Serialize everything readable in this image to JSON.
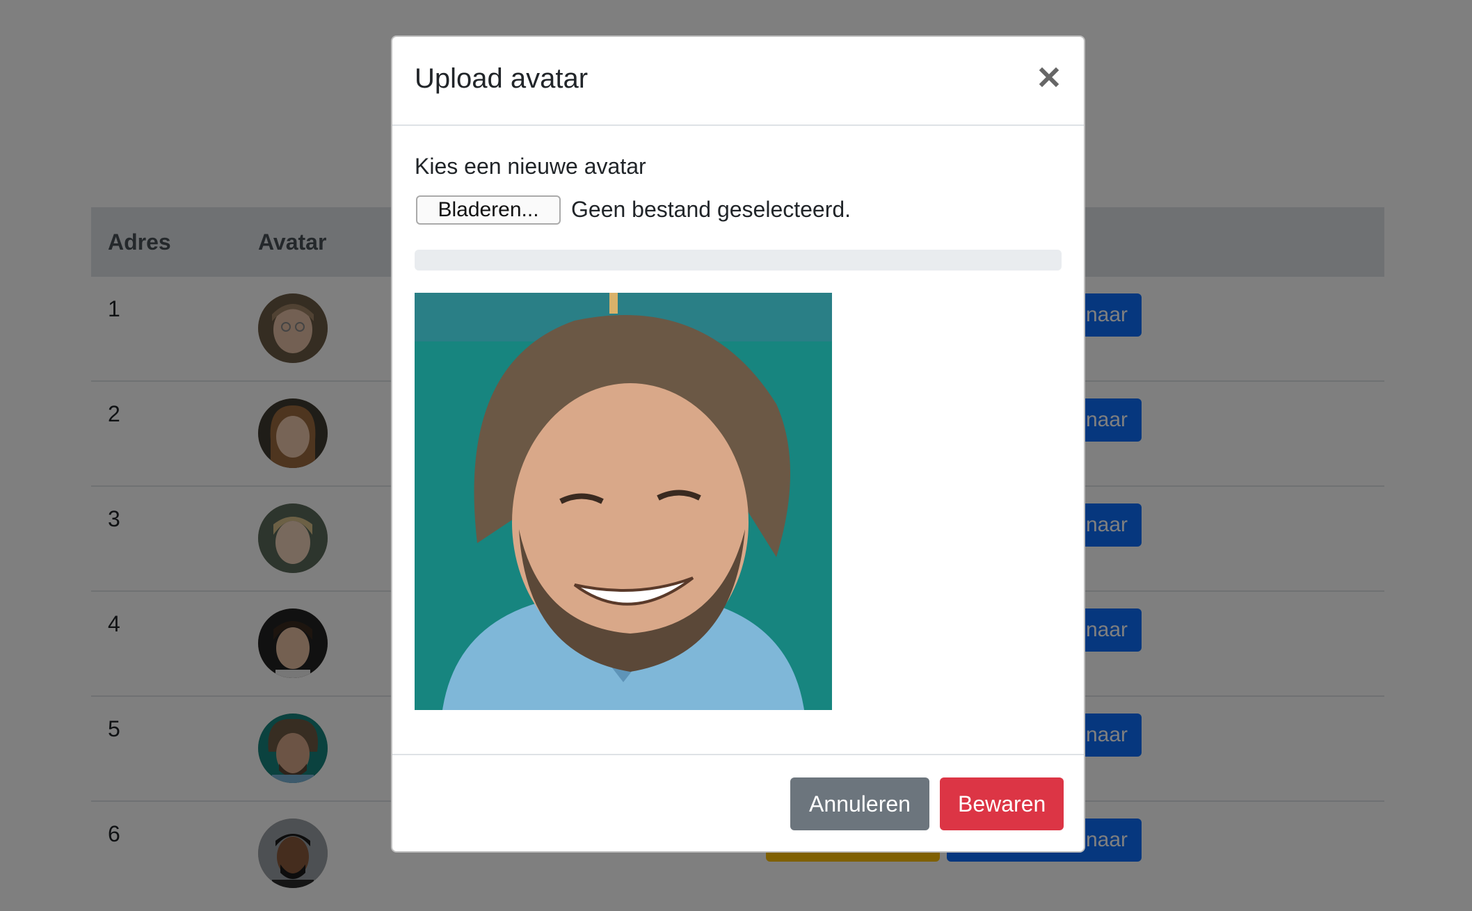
{
  "table": {
    "columns": [
      "Adres",
      "Avatar"
    ],
    "rows": [
      {
        "address": "1",
        "action_label": "enaar"
      },
      {
        "address": "2",
        "action_label": "enaar"
      },
      {
        "address": "3",
        "action_label": "enaar"
      },
      {
        "address": "4",
        "action_label": "enaar"
      },
      {
        "address": "5",
        "action_label": "enaar"
      },
      {
        "address": "6",
        "action_label": "enaar"
      }
    ]
  },
  "modal": {
    "title": "Upload avatar",
    "close_icon": "close-icon",
    "label": "Kies een nieuwe avatar",
    "file_button": "Bladeren...",
    "file_status": "Geen bestand geselecteerd.",
    "progress": 0,
    "cancel_label": "Annuleren",
    "save_label": "Bewaren"
  },
  "colors": {
    "primary": "#0d6efd",
    "secondary": "#6c757d",
    "danger": "#dc3545",
    "warning": "#ffc107",
    "preview_bg": "#17857f"
  }
}
